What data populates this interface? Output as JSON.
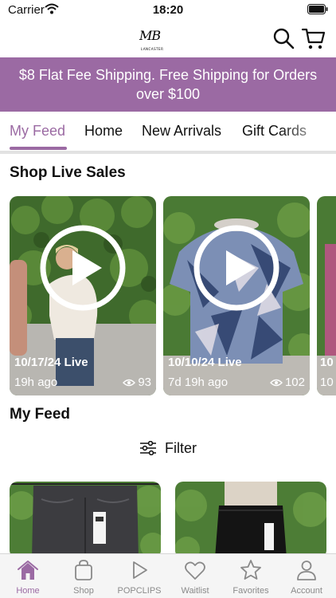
{
  "status_bar": {
    "carrier": "Carrier",
    "time": "18:20"
  },
  "header": {
    "logo_text": "MB",
    "logo_subtext": "LANCASTER"
  },
  "promo": {
    "text": "$8 Flat Fee Shipping.  Free Shipping for Orders\nover $100"
  },
  "tabs": [
    {
      "label": "My Feed",
      "active": true
    },
    {
      "label": "Home"
    },
    {
      "label": "New Arrivals"
    },
    {
      "label": "Gift Cards"
    }
  ],
  "live_section": {
    "title": "Shop Live Sales",
    "cards": [
      {
        "date": "10/17/24 Live",
        "ago": "19h ago",
        "views": "93"
      },
      {
        "date": "10/10/24 Live",
        "ago": "7d 19h ago",
        "views": "102"
      },
      {
        "date": "10",
        "ago": "10"
      }
    ]
  },
  "feed_section": {
    "title": "My Feed",
    "filter_label": "Filter"
  },
  "bottom_nav": [
    {
      "label": "Home",
      "icon": "home-icon",
      "active": true
    },
    {
      "label": "Shop",
      "icon": "shopping-bag-icon"
    },
    {
      "label": "POPCLIPS",
      "icon": "play-icon"
    },
    {
      "label": "Waitlist",
      "icon": "heart-icon"
    },
    {
      "label": "Favorites",
      "icon": "star-icon"
    },
    {
      "label": "Account",
      "icon": "person-icon"
    }
  ],
  "colors": {
    "accent": "#9b6aa3",
    "inactive": "#8a8a8a"
  }
}
